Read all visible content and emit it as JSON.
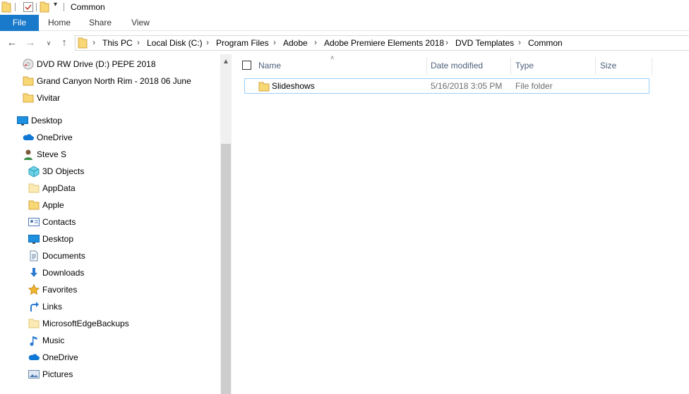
{
  "window": {
    "title": "Common"
  },
  "ribbon": {
    "tabs": [
      "File",
      "Home",
      "Share",
      "View"
    ]
  },
  "address": {
    "crumbs": [
      "This PC",
      "Local Disk (C:)",
      "Program Files",
      "Adobe",
      "Adobe Premiere Elements 2018",
      "DVD Templates",
      "Common"
    ]
  },
  "nav": {
    "items": [
      {
        "label": "DVD RW Drive (D:) PEPE 2018",
        "icon": "dvd-drive-icon"
      },
      {
        "label": "Grand Canyon North Rim - 2018 06 June",
        "icon": "folder-icon"
      },
      {
        "label": "Vivitar",
        "icon": "folder-icon"
      },
      {
        "label": "Desktop",
        "icon": "desktop-icon"
      },
      {
        "label": "OneDrive",
        "icon": "onedrive-icon"
      },
      {
        "label": "Steve S",
        "icon": "user-icon"
      },
      {
        "label": "3D Objects",
        "icon": "3d-objects-icon"
      },
      {
        "label": "AppData",
        "icon": "folder-pale-icon"
      },
      {
        "label": "Apple",
        "icon": "folder-icon"
      },
      {
        "label": "Contacts",
        "icon": "contacts-icon"
      },
      {
        "label": "Desktop",
        "icon": "desktop-icon"
      },
      {
        "label": "Documents",
        "icon": "documents-icon"
      },
      {
        "label": "Downloads",
        "icon": "downloads-icon"
      },
      {
        "label": "Favorites",
        "icon": "star-icon"
      },
      {
        "label": "Links",
        "icon": "links-icon"
      },
      {
        "label": "MicrosoftEdgeBackups",
        "icon": "folder-pale-icon"
      },
      {
        "label": "Music",
        "icon": "music-icon"
      },
      {
        "label": "OneDrive",
        "icon": "onedrive-icon"
      },
      {
        "label": "Pictures",
        "icon": "pictures-icon"
      }
    ]
  },
  "columns": [
    "Name",
    "Date modified",
    "Type",
    "Size"
  ],
  "files": [
    {
      "name": "Slideshows",
      "date": "5/16/2018 3:05 PM",
      "type": "File folder",
      "size": ""
    }
  ],
  "colors": {
    "accent": "#1979ca",
    "folder": "#f8d775",
    "selection_border": "#99d1ff"
  }
}
